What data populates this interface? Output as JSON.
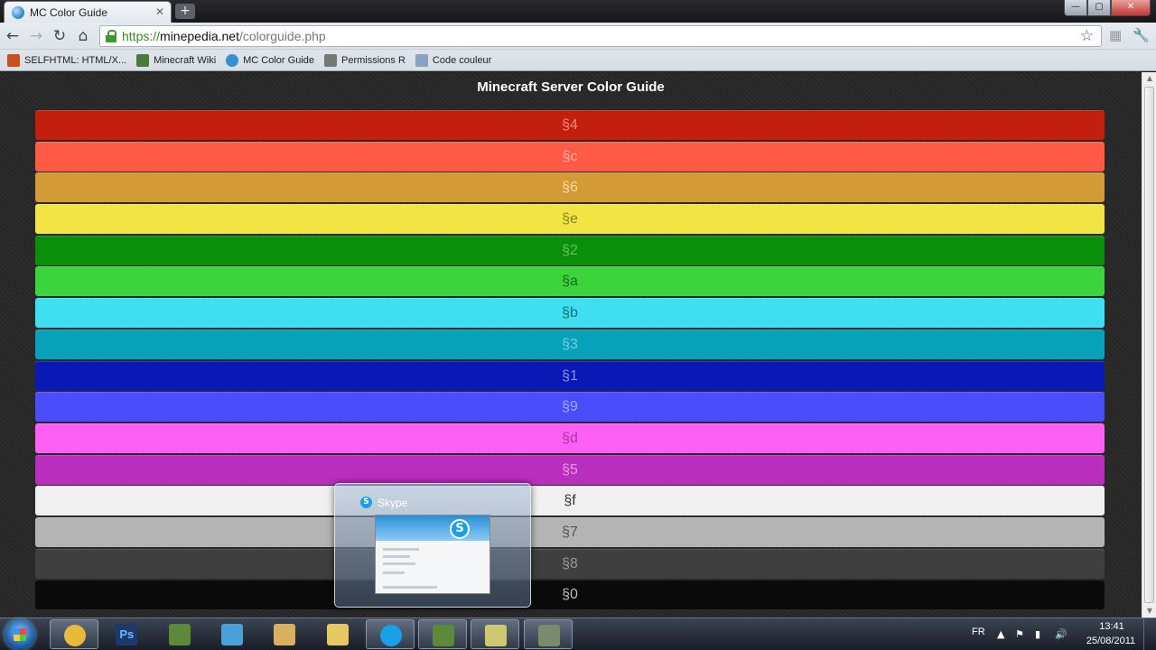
{
  "browser": {
    "tab_title": "MC Color Guide",
    "tab_close": "✕",
    "new_tab": "+",
    "url_scheme": "https://",
    "url_host": "minepedia.net",
    "url_path": "/colorguide.php",
    "back": "←",
    "forward": "→",
    "reload": "↻",
    "home": "⌂",
    "star": "☆",
    "wrench": "🔧",
    "window": {
      "minimize": "—",
      "maximize": "▢",
      "close": "✕"
    }
  },
  "bookmarks": [
    {
      "label": "SELFHTML: HTML/X...",
      "icon": "selfhtml-icon",
      "color": "#c8501e"
    },
    {
      "label": "Minecraft Wiki",
      "icon": "minecraft-wiki-icon",
      "color": "#4a7a3a"
    },
    {
      "label": "MC Color Guide",
      "icon": "globe-icon",
      "color": "#3a8fd0"
    },
    {
      "label": "Permissions R",
      "icon": "permissions-icon",
      "color": "#777777"
    },
    {
      "label": "Code couleur",
      "icon": "document-icon",
      "color": "#8aa2c0"
    }
  ],
  "page": {
    "title": "Minecraft Server Color Guide",
    "colors": [
      {
        "code": "§4",
        "bg": "#c31f0f",
        "fg": "#e88a80"
      },
      {
        "code": "§c",
        "bg": "#ff5a45",
        "fg": "#ffb3a8"
      },
      {
        "code": "§6",
        "bg": "#d49a35",
        "fg": "#f2d9a8"
      },
      {
        "code": "§e",
        "bg": "#f2e543",
        "fg": "#8a8230"
      },
      {
        "code": "§2",
        "bg": "#0a8f0a",
        "fg": "#66c066"
      },
      {
        "code": "§a",
        "bg": "#3cd43c",
        "fg": "#1d6a1d"
      },
      {
        "code": "§b",
        "bg": "#3ddff0",
        "fg": "#17717a"
      },
      {
        "code": "§3",
        "bg": "#07a2ba",
        "fg": "#70cedd"
      },
      {
        "code": "§1",
        "bg": "#0a18b5",
        "fg": "#8a93e0"
      },
      {
        "code": "§9",
        "bg": "#4a4dfa",
        "fg": "#a5a7ff"
      },
      {
        "code": "§d",
        "bg": "#fe5ff5",
        "fg": "#a63aa0"
      },
      {
        "code": "§5",
        "bg": "#b92ebc",
        "fg": "#e49be6"
      },
      {
        "code": "§f",
        "bg": "#f0f0f0",
        "fg": "#333333"
      },
      {
        "code": "§7",
        "bg": "#b4b4b4",
        "fg": "#555555"
      },
      {
        "code": "§8",
        "bg": "#3f3f3f",
        "fg": "#999999"
      },
      {
        "code": "§0",
        "bg": "#0a0a0a",
        "fg": "#bbbbbb"
      }
    ]
  },
  "preview": {
    "title": "Skype"
  },
  "taskbar": {
    "items": [
      {
        "name": "chrome",
        "color": "#e8b93a",
        "pinned": true
      },
      {
        "name": "photoshop",
        "color": "#1b3a6b",
        "label": "Ps",
        "pinned": false
      },
      {
        "name": "minecraft",
        "color": "#5c8a3a",
        "pinned": false
      },
      {
        "name": "messenger",
        "color": "#4aa0d8",
        "pinned": false
      },
      {
        "name": "mail",
        "color": "#d8b060",
        "pinned": false
      },
      {
        "name": "explorer",
        "color": "#e8c860",
        "pinned": false
      },
      {
        "name": "skype",
        "color": "#1aa0e8",
        "pinned": true
      },
      {
        "name": "minecraft-2",
        "color": "#5c8a3a",
        "pinned": true
      },
      {
        "name": "notes",
        "color": "#d0c870",
        "pinned": true
      },
      {
        "name": "tool",
        "color": "#7a8a6a",
        "pinned": true
      }
    ],
    "language": "FR",
    "time": "13:41",
    "date": "25/08/2011"
  }
}
